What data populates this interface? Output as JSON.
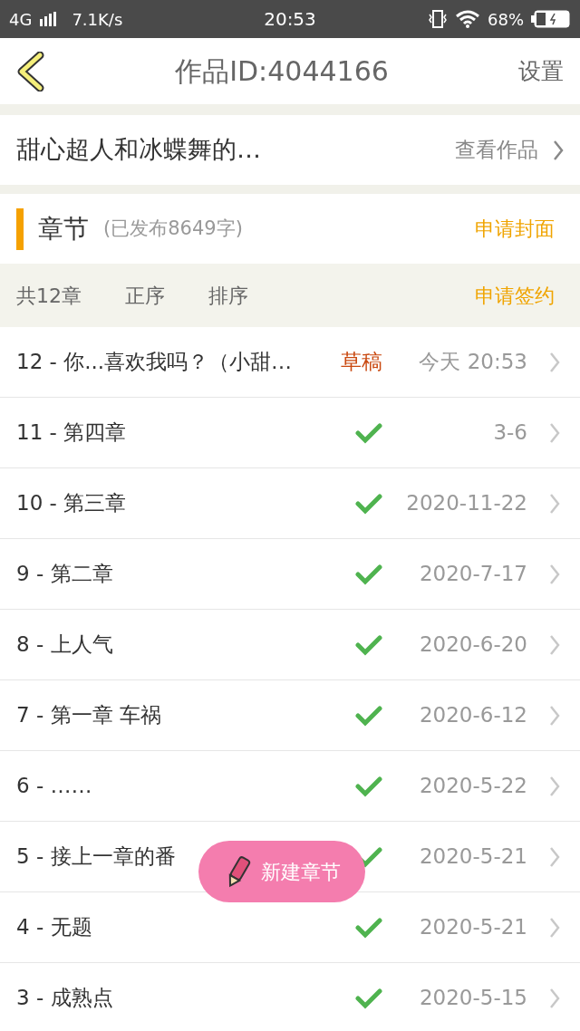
{
  "status_bar": {
    "network": "4G",
    "speed": "7.1K/s",
    "time": "20:53",
    "battery": "68%"
  },
  "header": {
    "title": "作品ID:4044166",
    "action": "设置"
  },
  "book": {
    "title": "甜心超人和冰蝶舞的…",
    "link": "查看作品"
  },
  "section": {
    "title": "章节",
    "subtitle": "(已发布8649字)",
    "action": "申请封面"
  },
  "toolbar": {
    "count": "共12章",
    "order": "正序",
    "sort": "排序",
    "action": "申请签约"
  },
  "chapters": [
    {
      "title": "12 - 你...喜欢我吗？（小甜…",
      "kind": "draft",
      "status": "草稿",
      "date": "今天 20:53"
    },
    {
      "title": "11 - 第四章",
      "kind": "published",
      "date": "3-6"
    },
    {
      "title": "10 - 第三章",
      "kind": "published",
      "date": "2020-11-22"
    },
    {
      "title": "9 - 第二章",
      "kind": "published",
      "date": "2020-7-17"
    },
    {
      "title": "8 - 上人气",
      "kind": "published",
      "date": "2020-6-20"
    },
    {
      "title": "7 - 第一章  车祸",
      "kind": "published",
      "date": "2020-6-12"
    },
    {
      "title": "6 - ……",
      "kind": "published",
      "date": "2020-5-22"
    },
    {
      "title": "5 - 接上一章的番",
      "kind": "published",
      "date": "2020-5-21"
    },
    {
      "title": "4 - 无题",
      "kind": "published",
      "date": "2020-5-21"
    },
    {
      "title": "3 - 成熟点",
      "kind": "published",
      "date": "2020-5-15"
    }
  ],
  "fab": {
    "label": "新建章节"
  }
}
